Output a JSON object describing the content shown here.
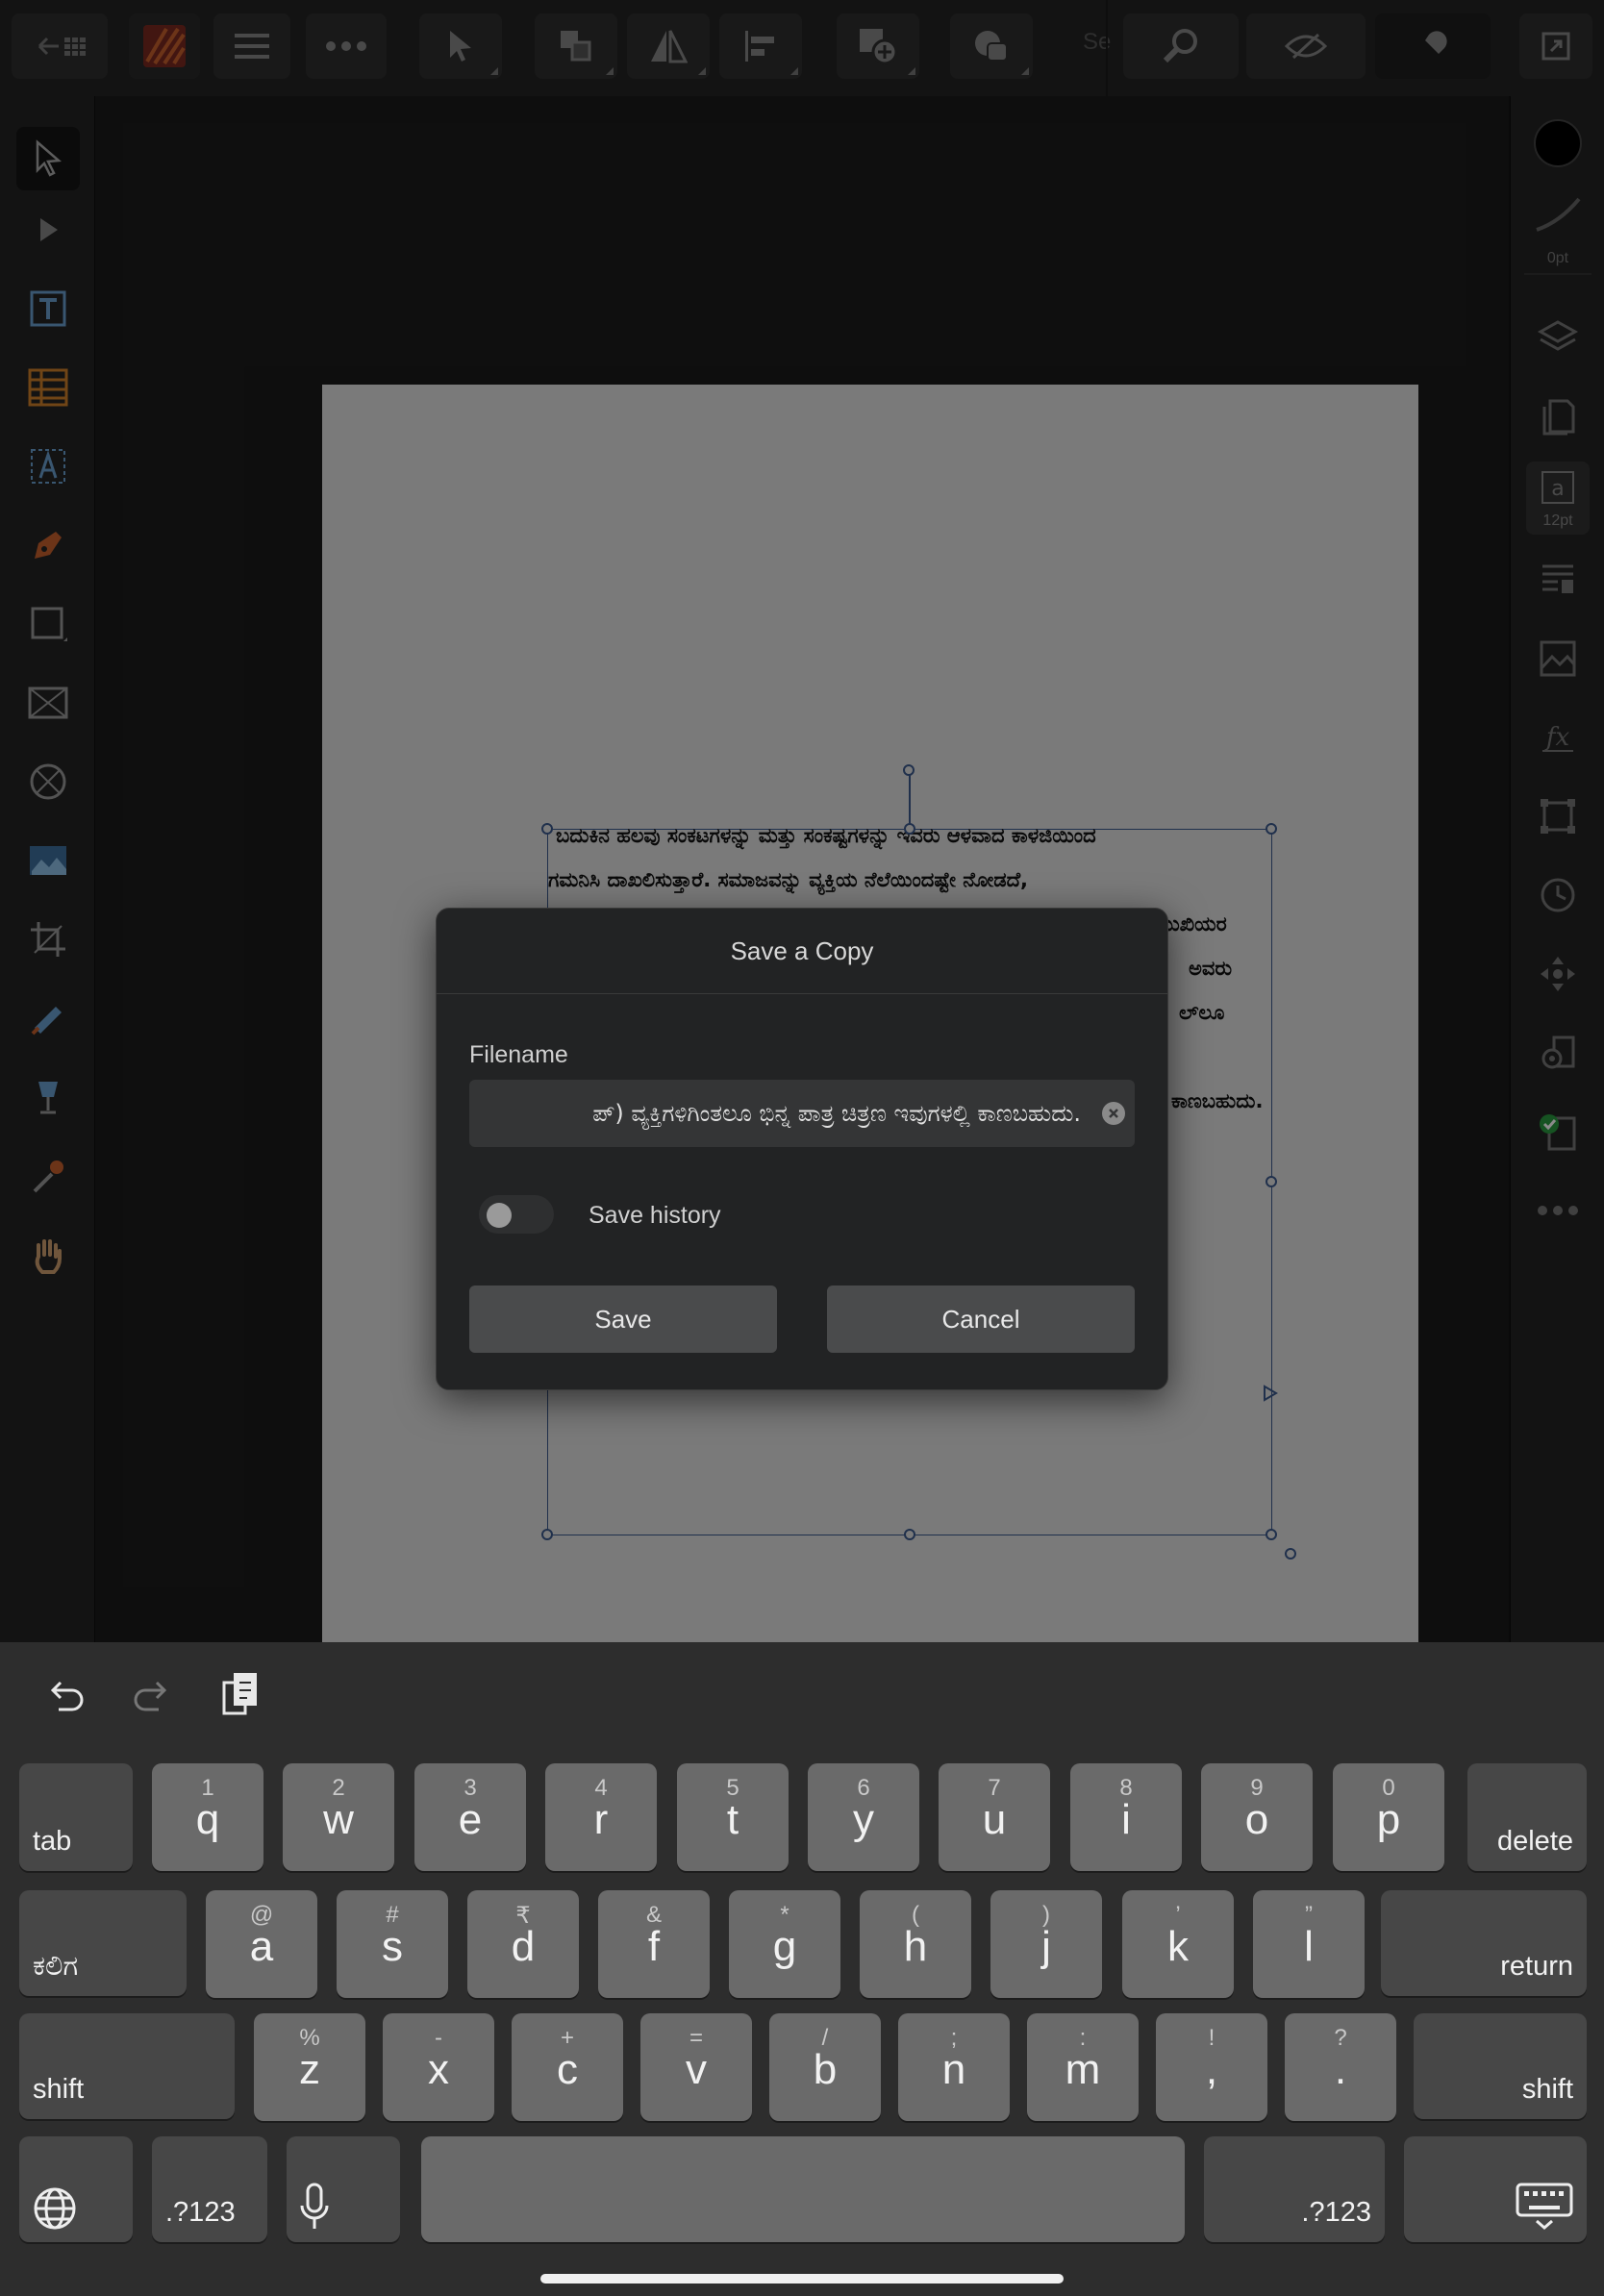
{
  "toolbar": {
    "search_partial": "Se",
    "icons": [
      "back-grid-icon",
      "app-logo-icon",
      "menu-icon",
      "more-icon",
      "move-tool-icon",
      "arrange-icon",
      "flip-icon",
      "align-icon",
      "insert-icon",
      "boolean-icon",
      "zoom-icon",
      "preview-icon",
      "snapping-icon",
      "fullscreen-icon"
    ]
  },
  "left_tools": [
    "move-tool-icon",
    "node-tool-icon",
    "artistic-text-icon",
    "table-icon",
    "frame-text-icon",
    "pen-icon",
    "rectangle-icon",
    "picture-frame-icon",
    "ellipse-frame-icon",
    "place-image-icon",
    "crop-icon",
    "color-picker-icon",
    "fill-icon",
    "eyedropper-icon",
    "hand-icon"
  ],
  "right_studio": {
    "stroke_label": "0pt",
    "text_size_label": "12pt",
    "icons": [
      "color-swatch-icon",
      "stroke-icon",
      "layers-icon",
      "pages-icon",
      "text-styles-icon",
      "paragraph-icon",
      "image-icon",
      "fx-icon",
      "transform-icon",
      "history-icon",
      "navigator-icon",
      "settings-icon",
      "preflight-icon",
      "more-icon"
    ]
  },
  "document": {
    "text_lines": [
      "ಬದುಕಿನ ಹಲವು ಸಂಕಟಗಳನ್ನು ಮತ್ತು ಸಂಕಷ್ಟಗಳನ್ನು ಇವರು ಆಳವಾದ ಕಾಳಜಿಯಿಂದ",
      "ಗಮನಿಸಿ ದಾಖಲಿಸುತ್ತಾರೆ. ಸಮಾಜವನ್ನು ವ್ಯಕ್ತಿಯ ನೆಲೆಯಿಂದಷ್ಟೇ ನೋಡದೆ,",
      "ಮುಖಿಯರ",
      "ಅವರು",
      "ಲ್‌ಲೂ",
      "ಕಾಣಬಹುದು."
    ]
  },
  "dialog": {
    "title": "Save a Copy",
    "filename_label": "Filename",
    "filename_value": "ಪ್) ವ್ಯಕ್ತಿಗಳಿಗಿಂತಲೂ ಭಿನ್ನ ಪಾತ್ರ ಚಿತ್ರಣ ಇವುಗಳಲ್ಲಿ ಕಾಣಬಹುದು.",
    "save_history_label": "Save history",
    "save_history_on": false,
    "save_label": "Save",
    "cancel_label": "Cancel"
  },
  "keyboard": {
    "row1": [
      [
        "1",
        "q"
      ],
      [
        "2",
        "w"
      ],
      [
        "3",
        "e"
      ],
      [
        "4",
        "r"
      ],
      [
        "5",
        "t"
      ],
      [
        "6",
        "y"
      ],
      [
        "7",
        "u"
      ],
      [
        "8",
        "i"
      ],
      [
        "9",
        "o"
      ],
      [
        "0",
        "p"
      ]
    ],
    "row2": [
      [
        "@",
        "a"
      ],
      [
        "#",
        "s"
      ],
      [
        "₹",
        "d"
      ],
      [
        "&",
        "f"
      ],
      [
        "*",
        "g"
      ],
      [
        "(",
        "h"
      ],
      [
        ")",
        "j"
      ],
      [
        "’",
        "k"
      ],
      [
        "”",
        "l"
      ]
    ],
    "row3": [
      [
        "%",
        "z"
      ],
      [
        "-",
        "x"
      ],
      [
        "+",
        "c"
      ],
      [
        "=",
        "v"
      ],
      [
        "/",
        "b"
      ],
      [
        ";",
        "n"
      ],
      [
        ":",
        "m"
      ],
      [
        "!",
        ","
      ],
      [
        "?",
        "."
      ]
    ],
    "tab": "tab",
    "delete": "delete",
    "lang": "ಕಲಿಗ",
    "return": "return",
    "shift": "shift",
    "numbers": ".?123"
  }
}
